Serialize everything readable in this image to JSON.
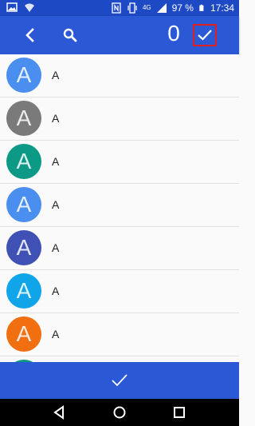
{
  "status_bar": {
    "battery_percent": "97 %",
    "network": "4G",
    "time": "17:34",
    "icons": [
      "image-icon",
      "wifi-icon",
      "nfc-icon",
      "vibrate-icon",
      "signal-icon",
      "battery-icon"
    ]
  },
  "app_bar": {
    "selected_count": "0",
    "back_icon": "back-arrow-icon",
    "search_icon": "search-icon",
    "confirm_icon": "checkmark-icon"
  },
  "contacts": [
    {
      "letter": "A",
      "name": "A",
      "color": "#4a8ff0"
    },
    {
      "letter": "A",
      "name": "A",
      "color": "#7a7a7a"
    },
    {
      "letter": "A",
      "name": "A",
      "color": "#0c9a86"
    },
    {
      "letter": "A",
      "name": "A",
      "color": "#4a8ff0"
    },
    {
      "letter": "A",
      "name": "A",
      "color": "#3f51b5"
    },
    {
      "letter": "A",
      "name": "A",
      "color": "#10a4e8"
    },
    {
      "letter": "A",
      "name": "A",
      "color": "#f16f10"
    },
    {
      "letter": "",
      "name": "",
      "color": "#0c9a86"
    }
  ],
  "bottom_action": {
    "icon": "checkmark-icon"
  },
  "colors": {
    "status_bar": "#1e49c4",
    "app_bar": "#2b59d6",
    "highlight_border": "#e02020",
    "list_background": "#fafafa"
  },
  "nav_bar": {
    "icons": [
      "back-triangle-icon",
      "home-circle-icon",
      "recents-square-icon"
    ]
  }
}
